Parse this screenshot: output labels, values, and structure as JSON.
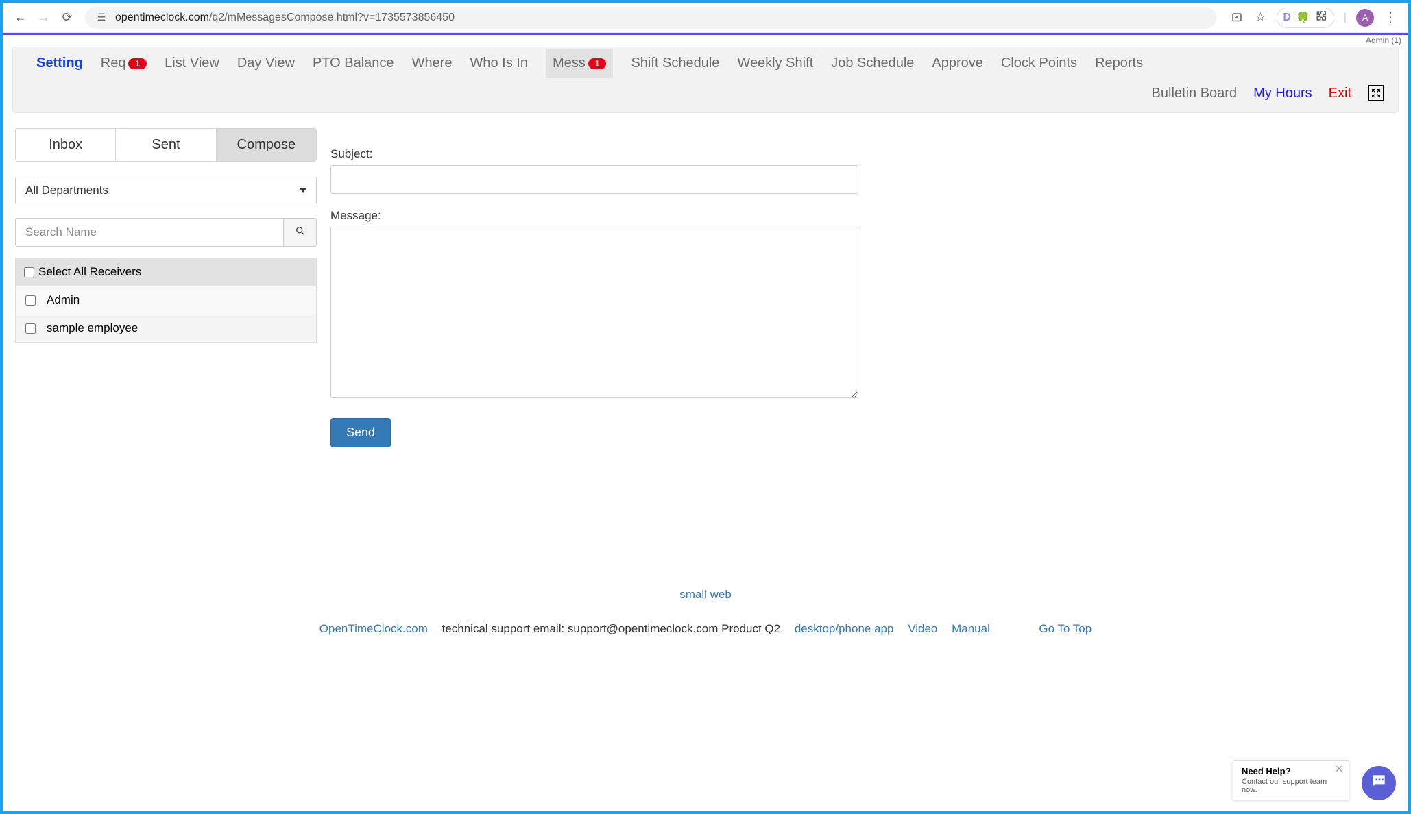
{
  "browser": {
    "url_host": "opentimeclock.com",
    "url_path": "/q2/mMessagesCompose.html?v=1735573856450",
    "avatar_letter": "A",
    "ext_d": "D"
  },
  "admin_label": "Admin (1)",
  "nav": {
    "items": [
      {
        "label": "Setting",
        "kind": "setting"
      },
      {
        "label": "Req",
        "badge": "1"
      },
      {
        "label": "List View"
      },
      {
        "label": "Day View"
      },
      {
        "label": "PTO Balance"
      },
      {
        "label": "Where"
      },
      {
        "label": "Who Is In"
      },
      {
        "label": "Mess",
        "badge": "1",
        "active": true
      },
      {
        "label": "Shift Schedule"
      },
      {
        "label": "Weekly Shift"
      },
      {
        "label": "Job Schedule"
      },
      {
        "label": "Approve"
      },
      {
        "label": "Clock Points"
      },
      {
        "label": "Reports"
      }
    ],
    "row2": {
      "bulletin": "Bulletin Board",
      "myhours": "My Hours",
      "exit": "Exit"
    }
  },
  "tabs": {
    "inbox": "Inbox",
    "sent": "Sent",
    "compose": "Compose"
  },
  "department_select": "All Departments",
  "search_placeholder": "Search Name",
  "select_all_label": "Select All Receivers",
  "receivers": [
    {
      "name": "Admin"
    },
    {
      "name": "sample employee"
    }
  ],
  "form": {
    "subject_label": "Subject:",
    "message_label": "Message:",
    "send_label": "Send",
    "subject_value": "",
    "message_value": ""
  },
  "footer": {
    "small_web": "small web",
    "brand": "OpenTimeClock.com",
    "support_text": " technical support email: support@opentimeclock.com Product Q2",
    "desktop": "desktop/phone app",
    "video": "Video",
    "manual": "Manual",
    "gototop": "Go To Top"
  },
  "help": {
    "title": "Need Help?",
    "subtitle": "Contact our support team now."
  }
}
